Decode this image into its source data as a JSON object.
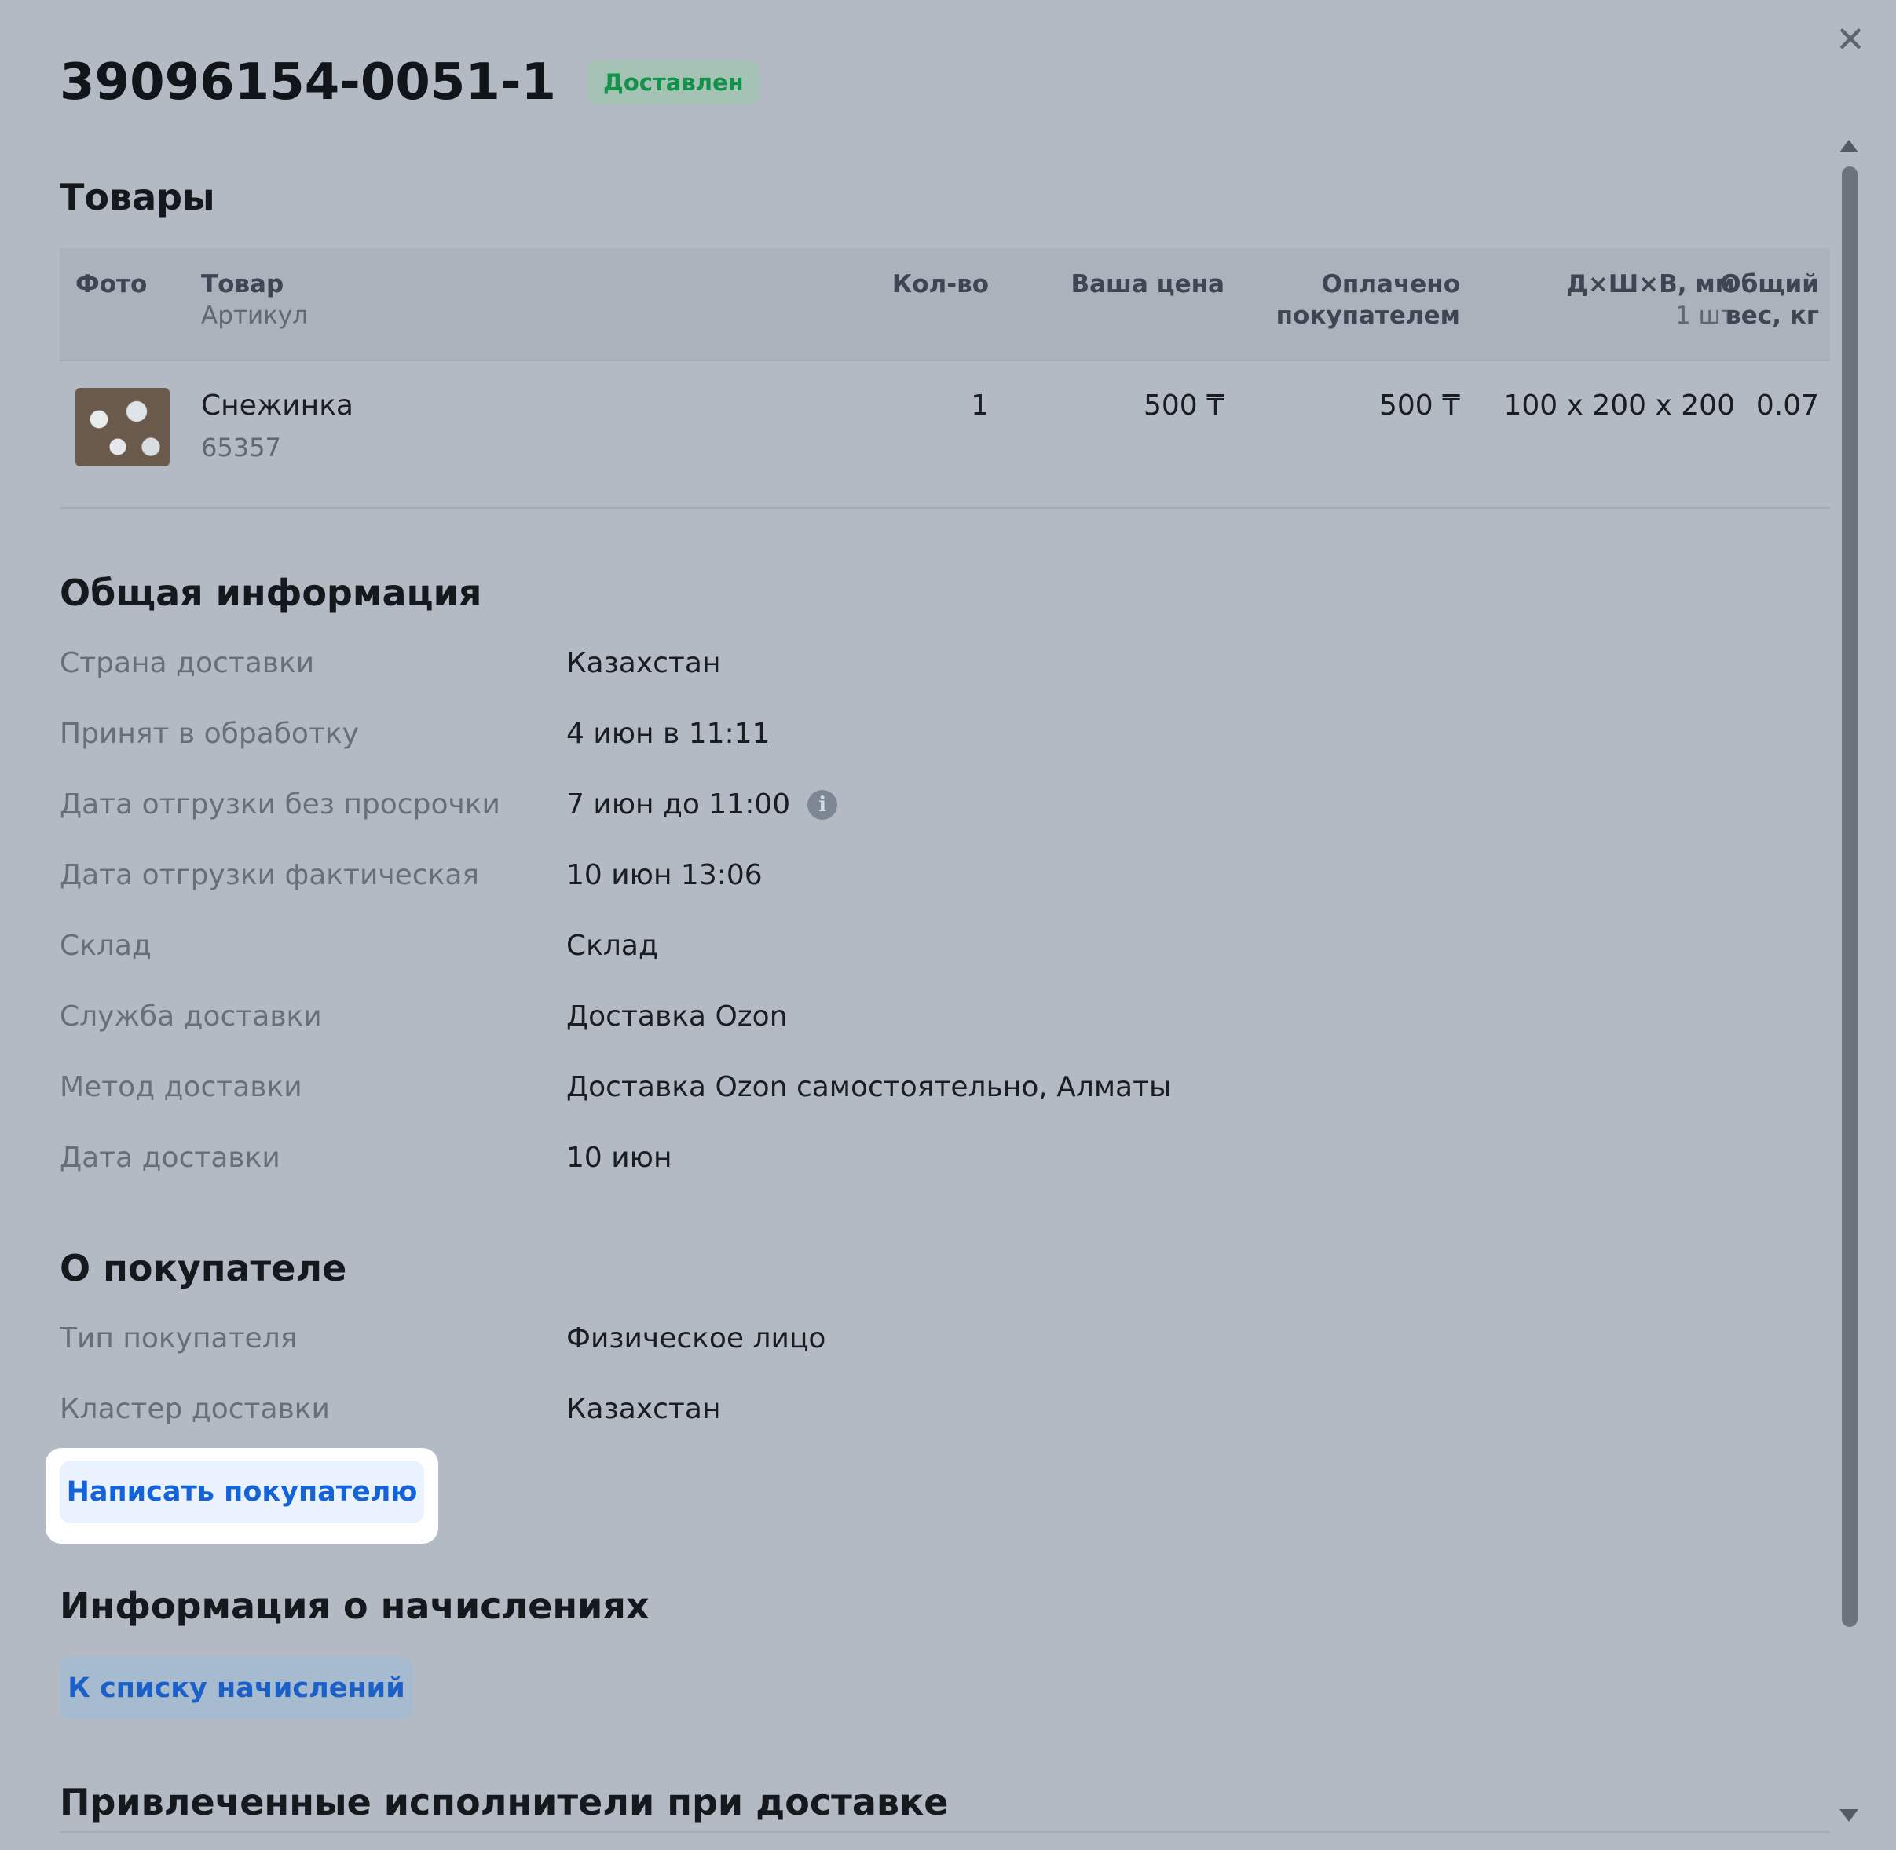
{
  "header": {
    "order_number": "39096154-0051-1",
    "status": "Доставлен",
    "close_symbol": "✕"
  },
  "products": {
    "title": "Товары",
    "columns": {
      "photo": "Фото",
      "product": "Товар",
      "article": "Артикул",
      "qty": "Кол-во",
      "your_price": "Ваша цена",
      "paid_line1": "Оплачено",
      "paid_line2": "покупателем",
      "dims": "Д×Ш×В, мм",
      "dims_unit": "1 шт",
      "weight_line1": "Общий",
      "weight_line2": "вес, кг"
    },
    "rows": [
      {
        "name": "Снежинка",
        "article": "65357",
        "qty": "1",
        "your_price": "500 ₸",
        "paid": "500 ₸",
        "dims": "100 x 200 x 200",
        "weight": "0.07"
      }
    ]
  },
  "general": {
    "title": "Общая информация",
    "rows": [
      {
        "label": "Страна доставки",
        "value": "Казахстан"
      },
      {
        "label": "Принят в обработку",
        "value": "4 июн в 11:11"
      },
      {
        "label": "Дата отгрузки без просрочки",
        "value": "7 июн до 11:00"
      },
      {
        "label": "Дата отгрузки фактическая",
        "value": "10 июн 13:06"
      },
      {
        "label": "Склад",
        "value": "Склад"
      },
      {
        "label": "Служба доставки",
        "value": "Доставка Ozon"
      },
      {
        "label": "Метод доставки",
        "value": "Доставка Ozon самостоятельно, Алматы"
      },
      {
        "label": "Дата доставки",
        "value": "10 июн"
      }
    ]
  },
  "buyer": {
    "title": "О покупателе",
    "rows": [
      {
        "label": "Тип покупателя",
        "value": "Физическое лицо"
      },
      {
        "label": "Кластер доставки",
        "value": "Казахстан"
      }
    ],
    "write_button": "Написать покупателю"
  },
  "accruals": {
    "title": "Информация о начислениях",
    "button": "К списку начислений"
  },
  "contractors": {
    "title": "Привлеченные исполнители при доставке"
  },
  "colors": {
    "overlay_bg": "#b3bac4",
    "status_green": "#12924a",
    "link_blue": "#1563d8"
  }
}
